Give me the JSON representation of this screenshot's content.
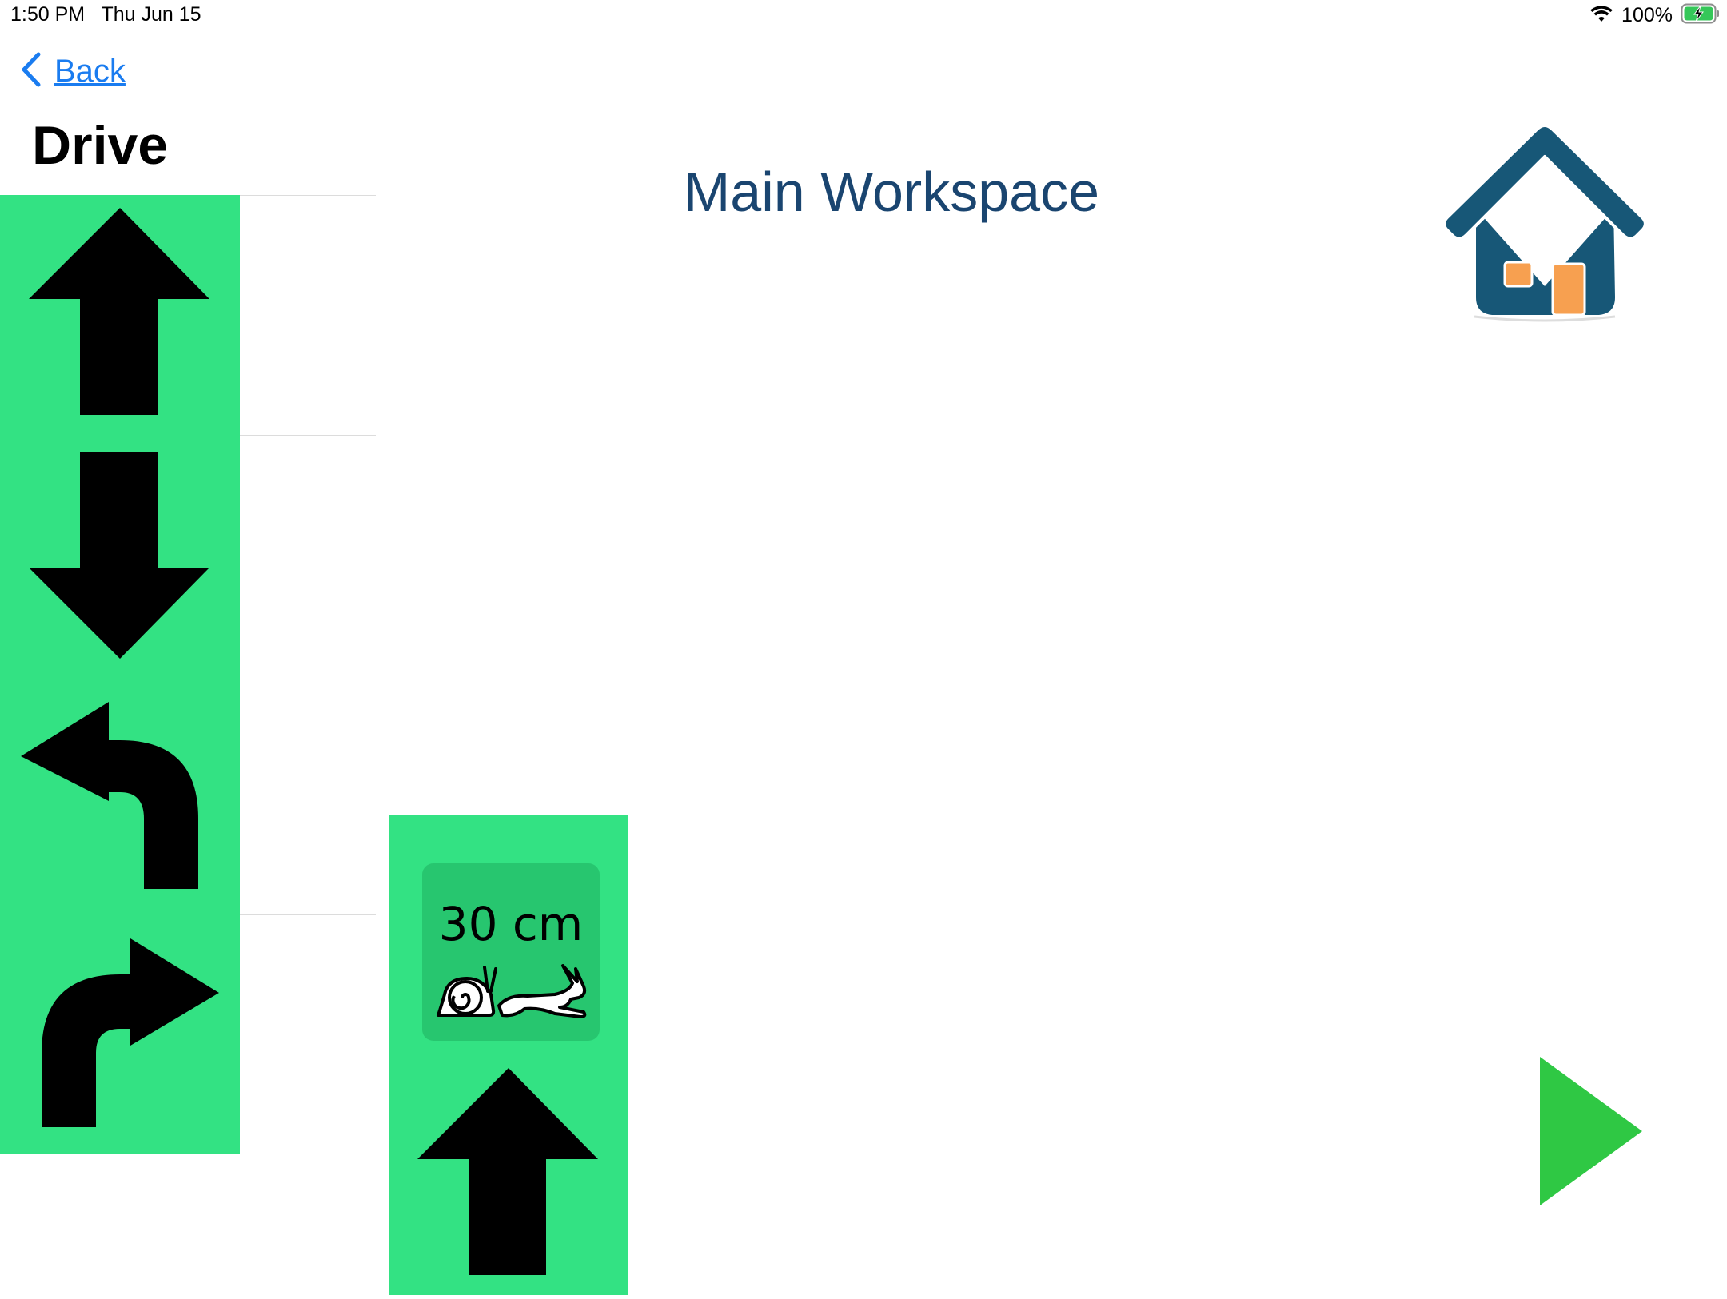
{
  "status_bar": {
    "time_date": "1:50 PM   Thu Jun 15",
    "battery_percent": "100%",
    "wifi_icon": "wifi-icon",
    "battery_icon": "battery-charging-icon"
  },
  "navigation": {
    "back_label": "Back",
    "back_icon": "chevron-left-icon"
  },
  "sidebar": {
    "title": "Drive",
    "items": [
      {
        "name": "drive-forward",
        "icon": "arrow-up-icon"
      },
      {
        "name": "drive-backward",
        "icon": "arrow-down-icon"
      },
      {
        "name": "turn-left",
        "icon": "turn-left-arrow-icon"
      },
      {
        "name": "turn-right",
        "icon": "turn-right-arrow-icon"
      }
    ]
  },
  "workspace": {
    "title": "Main Workspace",
    "home_icon": "home-icon",
    "play_icon": "play-icon"
  },
  "program": {
    "blocks": [
      {
        "type": "drive-forward",
        "distance_label": "30 cm",
        "speed_icons": [
          "snail-icon",
          "rabbit-icon"
        ]
      }
    ]
  },
  "colors": {
    "block_green": "#33e283",
    "chip_green": "#27c66f",
    "title_blue": "#1a4570",
    "link_blue": "#1a7cf0",
    "home_roof": "#175777",
    "home_door": "#f7a050",
    "play_green": "#2fc844"
  }
}
